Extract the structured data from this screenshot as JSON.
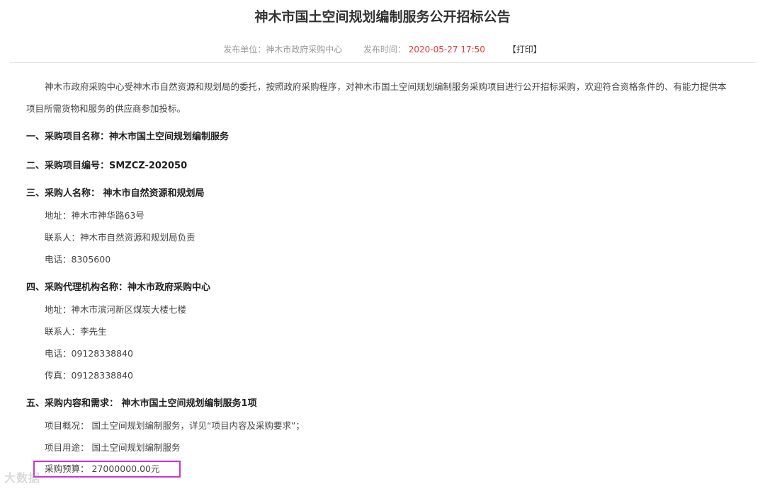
{
  "title": "神木市国土空间规划编制服务公开招标公告",
  "meta": {
    "publisher_label": "发布单位：神木市政府采购中心",
    "time_label": "发布时间：",
    "time_value": "2020-05-27 17:50",
    "print_label": "【打印】"
  },
  "intro": {
    "line1": "神木市政府采购中心受神木市自然资源和规划局的委托，按照政府采购程序，对神木市国土空间规划编制服务采购项目进行公开招标采购，欢迎符合资格条件的、有能力提供本",
    "line2": "项目所需货物和服务的供应商参加投标。"
  },
  "sections": {
    "s1": "一、采购项目名称：神木市国土空间规划编制服务",
    "s2": "二、采购项目编号：SMZCZ-202050",
    "s3": "三、采购人名称： 神木市自然资源和规划局",
    "s3_address": "地址：神木市神华路63号",
    "s3_contact": "联系人：神木市自然资源和规划局负责",
    "s3_phone": "电话：8305600",
    "s4": "四、采购代理机构名称：神木市政府采购中心",
    "s4_address": "地址：神木市滨河新区煤炭大楼七楼",
    "s4_contact": "联系人：李先生",
    "s4_phone": "电话：09128338840",
    "s4_fax": "传真：09128338840",
    "s5": "五、采购内容和需求： 神木市国土空间规划编制服务1项",
    "s5_overview": "项目概况： 国土空间规划编制服务，详见“项目内容及采购要求”；",
    "s5_usage": "项目用途： 国土空间规划编制服务",
    "s5_budget": "采购预算： 27000000.00元"
  },
  "watermark": "大数据"
}
